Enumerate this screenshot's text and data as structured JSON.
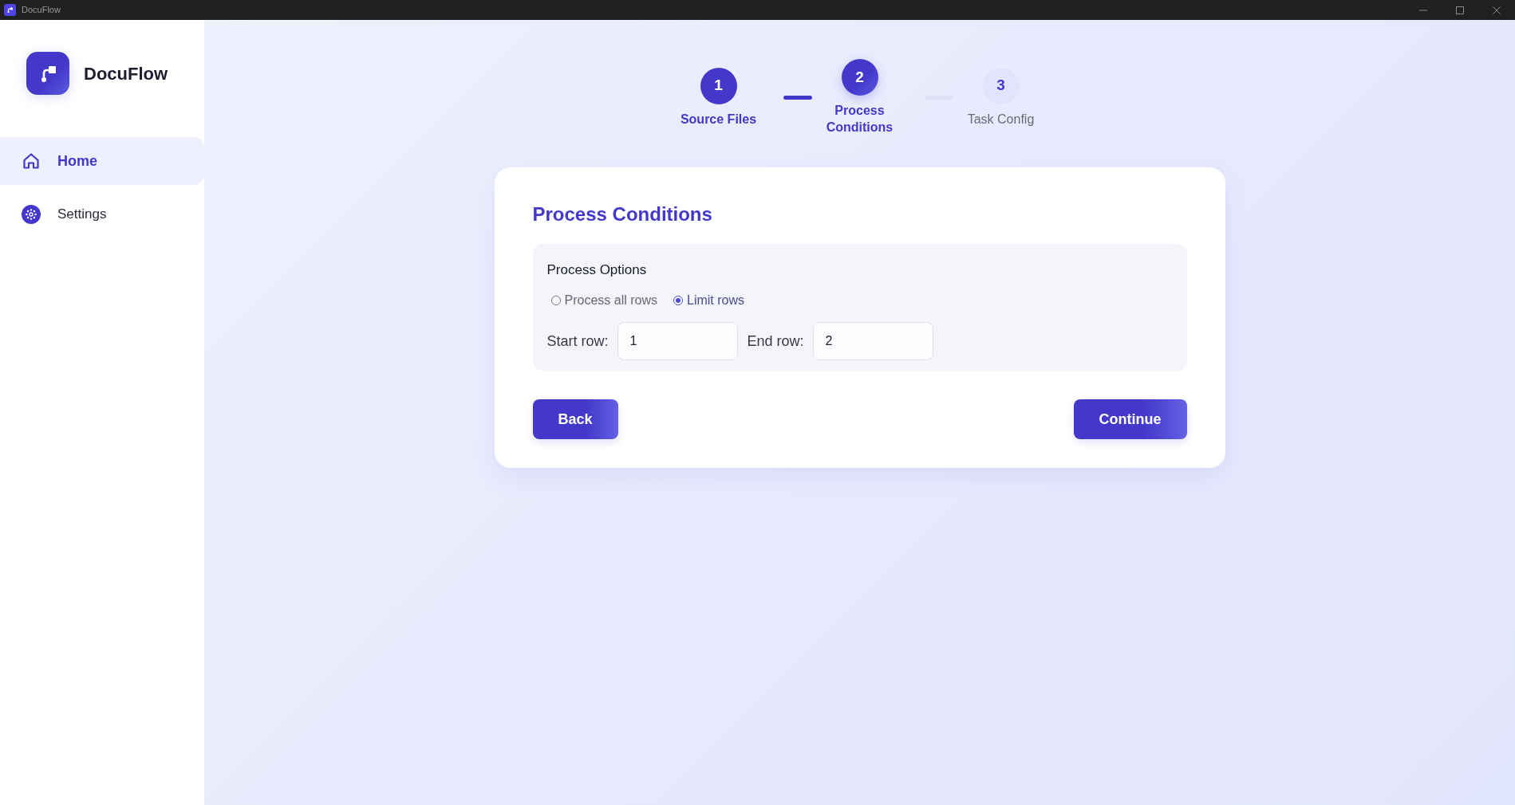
{
  "window": {
    "title": "DocuFlow"
  },
  "sidebar": {
    "brand": "DocuFlow",
    "items": [
      {
        "label": "Home",
        "kind": "home",
        "selected": true
      },
      {
        "label": "Settings",
        "kind": "settings",
        "selected": false
      }
    ]
  },
  "stepper": {
    "steps": [
      {
        "number": "1",
        "label": "Source Files",
        "selected": false
      },
      {
        "number": "2",
        "label": "Process Conditions",
        "selected": true
      },
      {
        "number": "3",
        "label": "Task Config",
        "selected": false
      }
    ]
  },
  "card": {
    "title": "Process Conditions",
    "options": {
      "title": "Process Options",
      "radios": [
        {
          "label": "Process all rows",
          "selected": false
        },
        {
          "label": "Limit rows",
          "selected": true
        }
      ],
      "fields": [
        {
          "label": "Start row:",
          "value": "1"
        },
        {
          "label": "End row:",
          "value": "2"
        }
      ]
    },
    "buttons": [
      {
        "label": "Back"
      },
      {
        "label": "Continue"
      }
    ]
  }
}
